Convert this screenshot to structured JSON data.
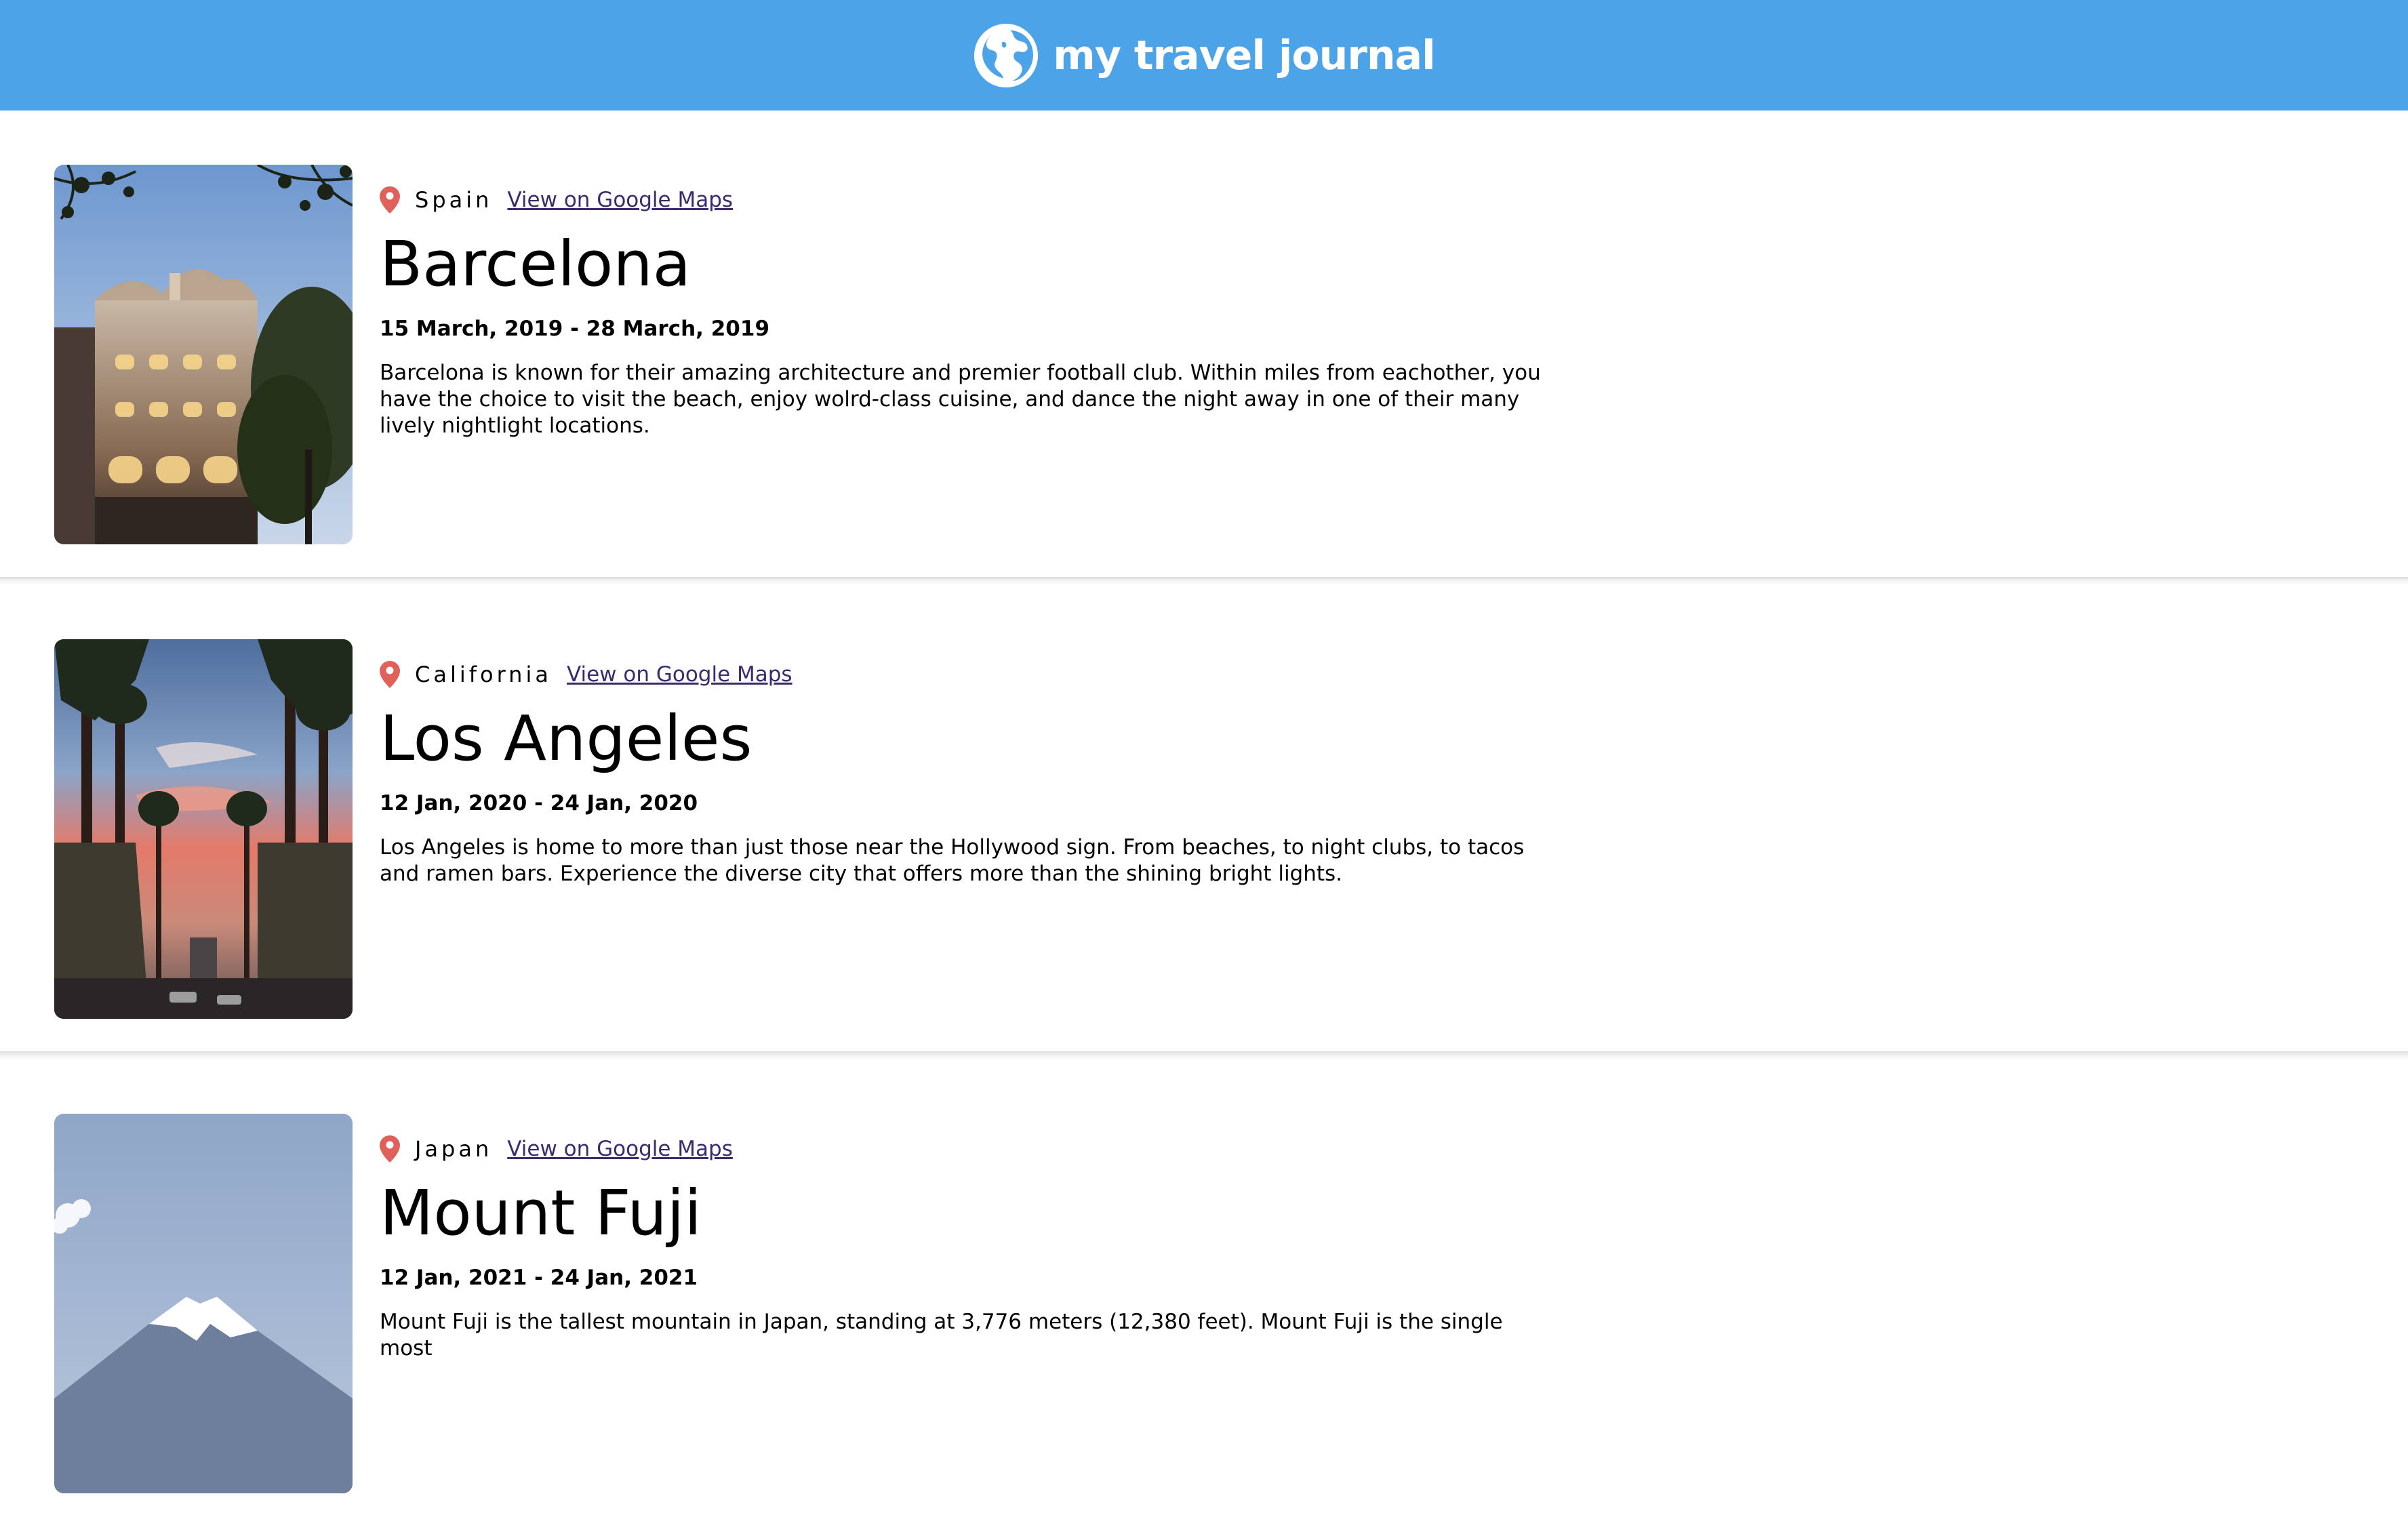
{
  "header": {
    "title": "my travel journal",
    "icon": "globe-icon",
    "background": "#4da3e8"
  },
  "entries": [
    {
      "country": "Spain",
      "map_link": "View on Google Maps",
      "title": "Barcelona",
      "dates": "15 March, 2019 - 28 March, 2019",
      "description": "Barcelona is known for their amazing architecture and premier football club. Within miles from eachother, you have the choice to visit the beach, enjoy wolrd-class cuisine, and dance the night away in one of their many lively nightlight locations."
    },
    {
      "country": "California",
      "map_link": "View on Google Maps",
      "title": "Los Angeles",
      "dates": "12 Jan, 2020 - 24 Jan, 2020",
      "description": "Los Angeles is home to more than just those near the Hollywood sign. From beaches, to night clubs, to tacos and ramen bars. Experience the diverse city that offers more than the shining bright lights."
    },
    {
      "country": "Japan",
      "map_link": "View on Google Maps",
      "title": "Mount Fuji",
      "dates": "12 Jan, 2021 - 24 Jan, 2021",
      "description": "Mount Fuji is the tallest mountain in Japan, standing at 3,776 meters (12,380 feet). Mount Fuji is the single most"
    }
  ],
  "colors": {
    "pin": "#e0605a",
    "link": "#3b2a6e",
    "header_text": "#ffffff"
  }
}
